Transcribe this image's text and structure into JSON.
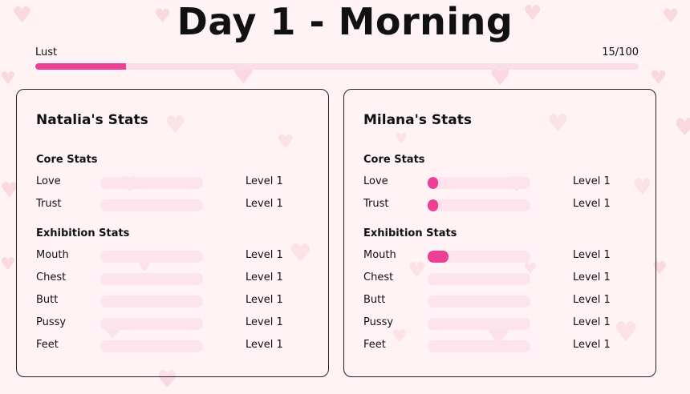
{
  "title": "Day 1 - Morning",
  "lust": {
    "label": "Lust",
    "value_text": "15/100",
    "value": 15,
    "max": 100,
    "fill_color": "#ec3f95"
  },
  "characters": [
    {
      "title": "Natalia's Stats",
      "core_title": "Core Stats",
      "core": [
        {
          "label": "Love",
          "level": "Level 1",
          "progress": 0
        },
        {
          "label": "Trust",
          "level": "Level 1",
          "progress": 0
        }
      ],
      "exhibition_title": "Exhibition Stats",
      "exhibition": [
        {
          "label": "Mouth",
          "level": "Level 1",
          "progress": 0
        },
        {
          "label": "Chest",
          "level": "Level 1",
          "progress": 0
        },
        {
          "label": "Butt",
          "level": "Level 1",
          "progress": 0
        },
        {
          "label": "Pussy",
          "level": "Level 1",
          "progress": 0
        },
        {
          "label": "Feet",
          "level": "Level 1",
          "progress": 0
        }
      ]
    },
    {
      "title": "Milana's Stats",
      "core_title": "Core Stats",
      "core": [
        {
          "label": "Love",
          "level": "Level 1",
          "progress": 0.1
        },
        {
          "label": "Trust",
          "level": "Level 1",
          "progress": 0.1
        }
      ],
      "exhibition_title": "Exhibition Stats",
      "exhibition": [
        {
          "label": "Mouth",
          "level": "Level 1",
          "progress": 0.2
        },
        {
          "label": "Chest",
          "level": "Level 1",
          "progress": 0
        },
        {
          "label": "Butt",
          "level": "Level 1",
          "progress": 0
        },
        {
          "label": "Pussy",
          "level": "Level 1",
          "progress": 0
        },
        {
          "label": "Feet",
          "level": "Level 1",
          "progress": 0
        }
      ]
    }
  ],
  "colors": {
    "background": "#fff3f6",
    "track": "#fde3ec",
    "accent": "#ec3f95",
    "heart": "#f9cfdc"
  },
  "icons": {
    "background_decoration": "heart-icon"
  }
}
